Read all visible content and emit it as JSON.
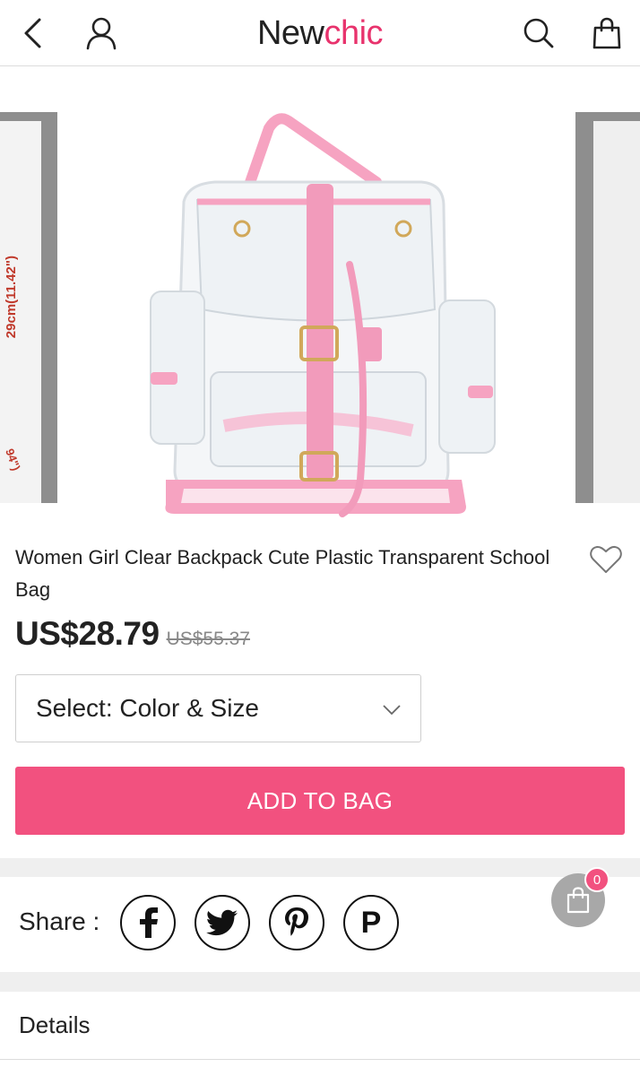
{
  "header": {
    "logo_part1": "New",
    "logo_part2": "chic",
    "icons": [
      "back-arrow-icon",
      "user-icon",
      "search-icon",
      "shopping-bag-icon"
    ]
  },
  "gallery": {
    "left_peek_text": "29cm(11.42\")",
    "left_peek_text2": "94\")"
  },
  "product": {
    "title": "Women Girl Clear Backpack Cute Plastic Transparent School Bag",
    "price": "US$28.79",
    "old_price": "US$55.37"
  },
  "select": {
    "label": "Select: Color & Size"
  },
  "actions": {
    "add_to_bag": "ADD TO BAG"
  },
  "share": {
    "label": "Share :",
    "networks": [
      "facebook-icon",
      "twitter-icon",
      "pinterest-icon",
      "p-icon"
    ],
    "p_letter": "P"
  },
  "cart": {
    "count": "0"
  },
  "details": {
    "label": "Details"
  },
  "colors": {
    "accent": "#f2517f",
    "brand_pink": "#e8336d"
  }
}
